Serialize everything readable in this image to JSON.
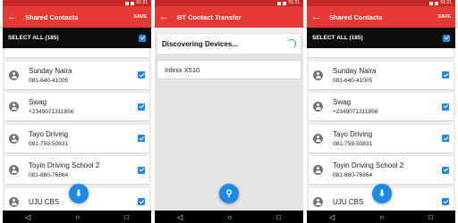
{
  "status": {
    "time": "01:21"
  },
  "screens": [
    {
      "title": "Shared Contacts",
      "save_label": "SAVE",
      "select_all_label": "SELECT ALL (185)",
      "contacts": [
        {
          "name": "Sunday Naira",
          "phone": "081-640-41005"
        },
        {
          "name": "Swag",
          "phone": "+2349071311856"
        },
        {
          "name": "Tayo Driving",
          "phone": "081-759-50831"
        },
        {
          "name": "Toyin Driving School 2",
          "phone": "081-860-76864"
        },
        {
          "name": "UJU CBS",
          "phone": ""
        }
      ]
    },
    {
      "title": "BT Contact Transfer",
      "discovering_label": "Discovering Devices...",
      "devices": [
        "Infinix X510"
      ]
    },
    {
      "title": "Shared Contacts",
      "save_label": "SAVE",
      "select_all_label": "SELECT ALL (185)",
      "contacts": [
        {
          "name": "Sunday Naira",
          "phone": "081-640-41005"
        },
        {
          "name": "Swag",
          "phone": "+2349071311856"
        },
        {
          "name": "Tayo Driving",
          "phone": "081-759-50831"
        },
        {
          "name": "Toyin Driving School 2",
          "phone": "081-860-76864"
        },
        {
          "name": "UJU CBS",
          "phone": ""
        }
      ]
    }
  ],
  "icons": {
    "back": "back-arrow-icon",
    "download": "download-icon",
    "search": "search-icon",
    "nav": [
      "nav-back-icon",
      "nav-home-icon",
      "nav-recents-icon"
    ]
  },
  "colors": {
    "appbar": "#e53935",
    "statusbar": "#c62828",
    "accent": "#1e88e5",
    "selectbar": "#0d0d0d"
  }
}
